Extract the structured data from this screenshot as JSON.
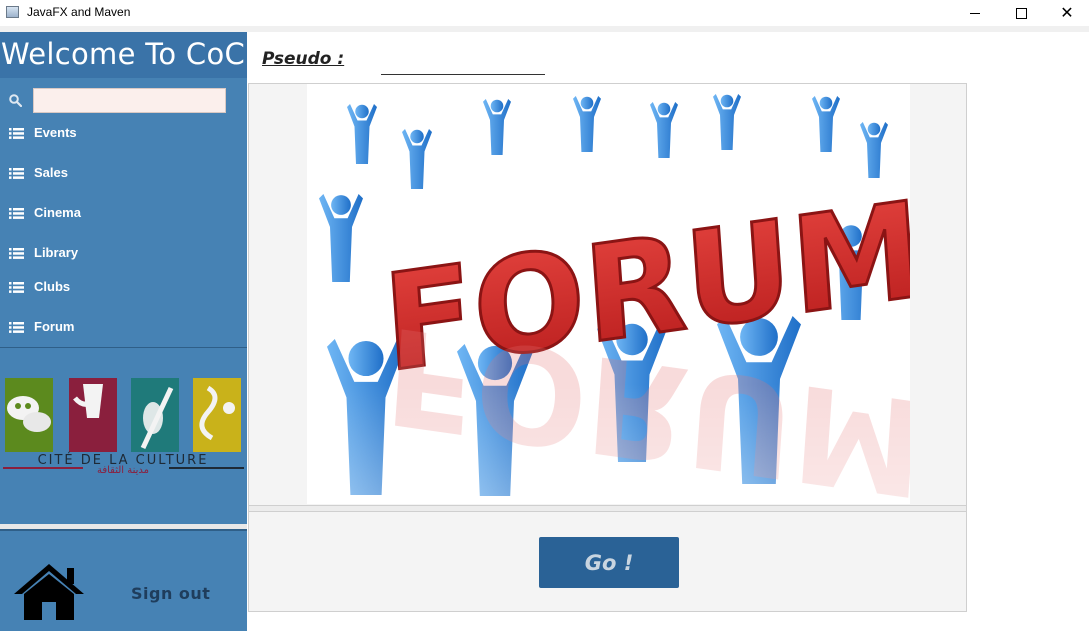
{
  "window": {
    "title": "JavaFX and Maven",
    "controls": {
      "minimize": "minimize-icon",
      "maximize": "maximize-icon",
      "close": "close-icon"
    }
  },
  "sidebar": {
    "header": "Welcome To CoC",
    "search": {
      "value": "",
      "placeholder": "",
      "icon": "search-icon"
    },
    "items": [
      {
        "label": "Events",
        "icon": "list-icon"
      },
      {
        "label": "Sales",
        "icon": "list-icon"
      },
      {
        "label": "Cinema",
        "icon": "list-icon"
      },
      {
        "label": "Library",
        "icon": "list-icon"
      },
      {
        "label": "Clubs",
        "icon": "list-icon"
      },
      {
        "label": "Forum",
        "icon": "list-icon"
      }
    ],
    "logo": {
      "text_fr": "CITÉ DE LA CULTURE",
      "text_ar": "مدينة الثقافة"
    },
    "home_icon": "home-icon",
    "signout": "Sign out"
  },
  "main": {
    "pseudo_label": "Pseudo  :",
    "pseudo_value": "",
    "image": {
      "word": "FORUM"
    },
    "go_button": "Go !"
  },
  "colors": {
    "sidebar": "#4682b4",
    "sidebar_header": "#3a73a8",
    "go_button": "#2a6296",
    "forum_text": "#d32f2f",
    "figures": "#3b8fde"
  }
}
